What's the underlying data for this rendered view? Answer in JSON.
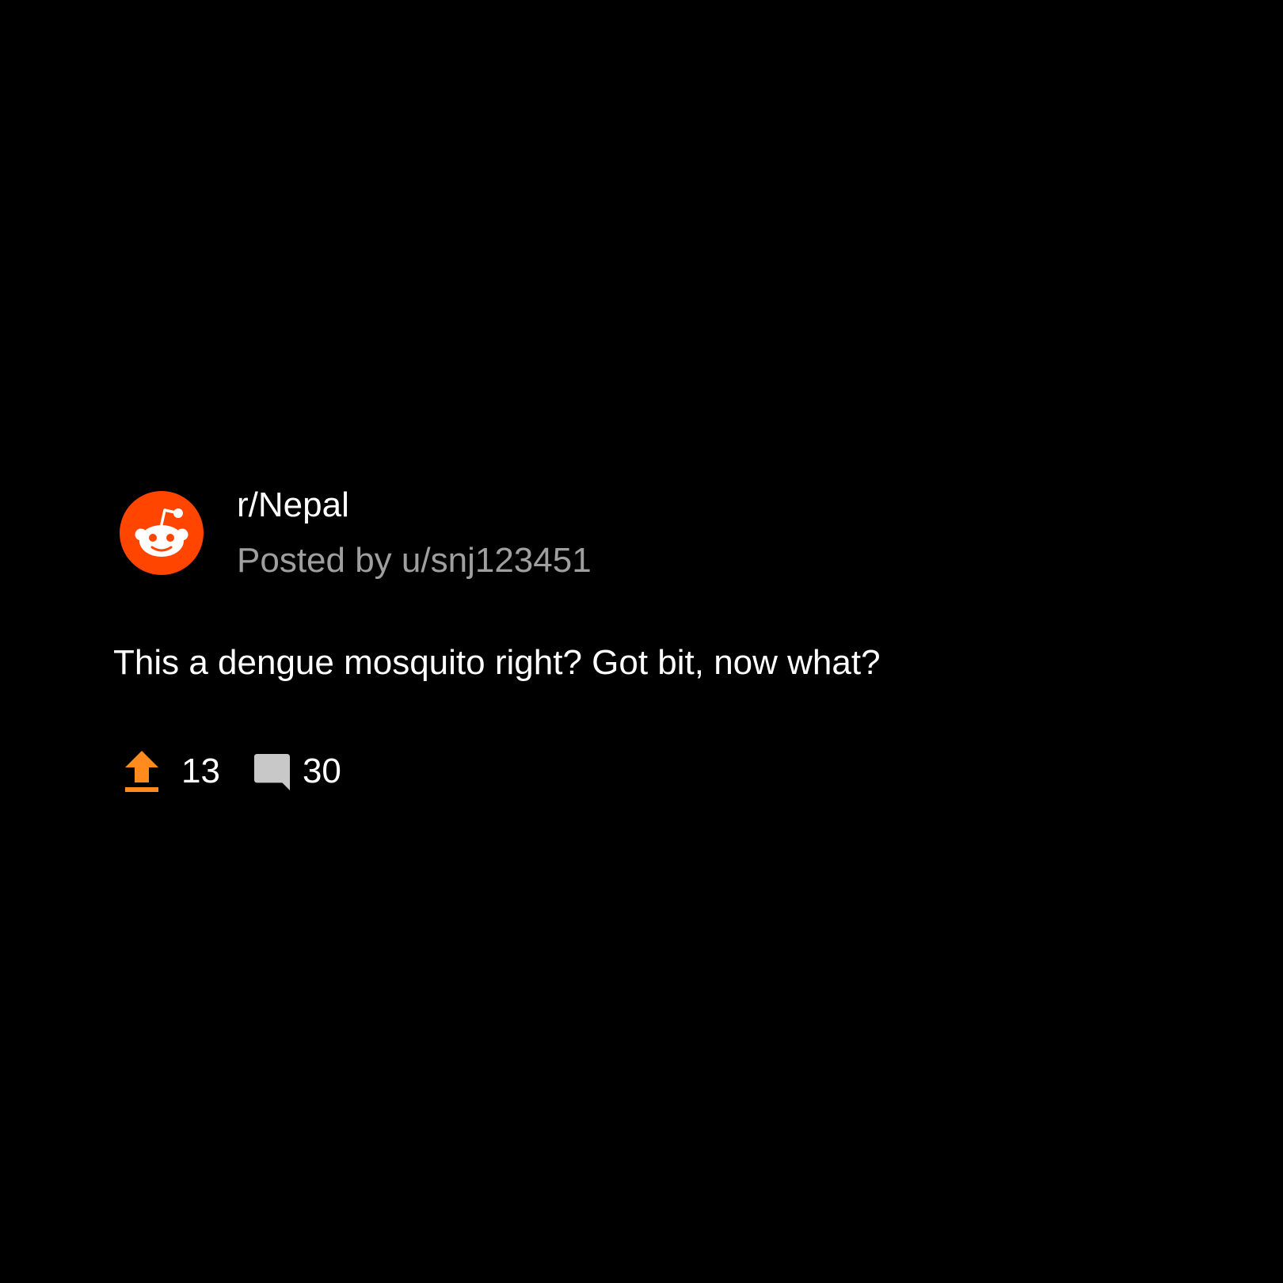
{
  "post": {
    "subreddit": "r/Nepal",
    "posted_by": "Posted by u/snj123451",
    "title": "This a dengue mosquito right? Got bit, now what?",
    "upvotes": "13",
    "comments": "30"
  },
  "icons": {
    "avatar": "reddit-snoo-icon",
    "upvote": "upvote-arrow-icon",
    "comment": "comment-bubble-icon"
  },
  "colors": {
    "background": "#000000",
    "brand": "#ff4500",
    "upvote": "#ff8b1f",
    "muted_text": "#9f9f9f",
    "comment_icon": "#c8c8c8"
  }
}
